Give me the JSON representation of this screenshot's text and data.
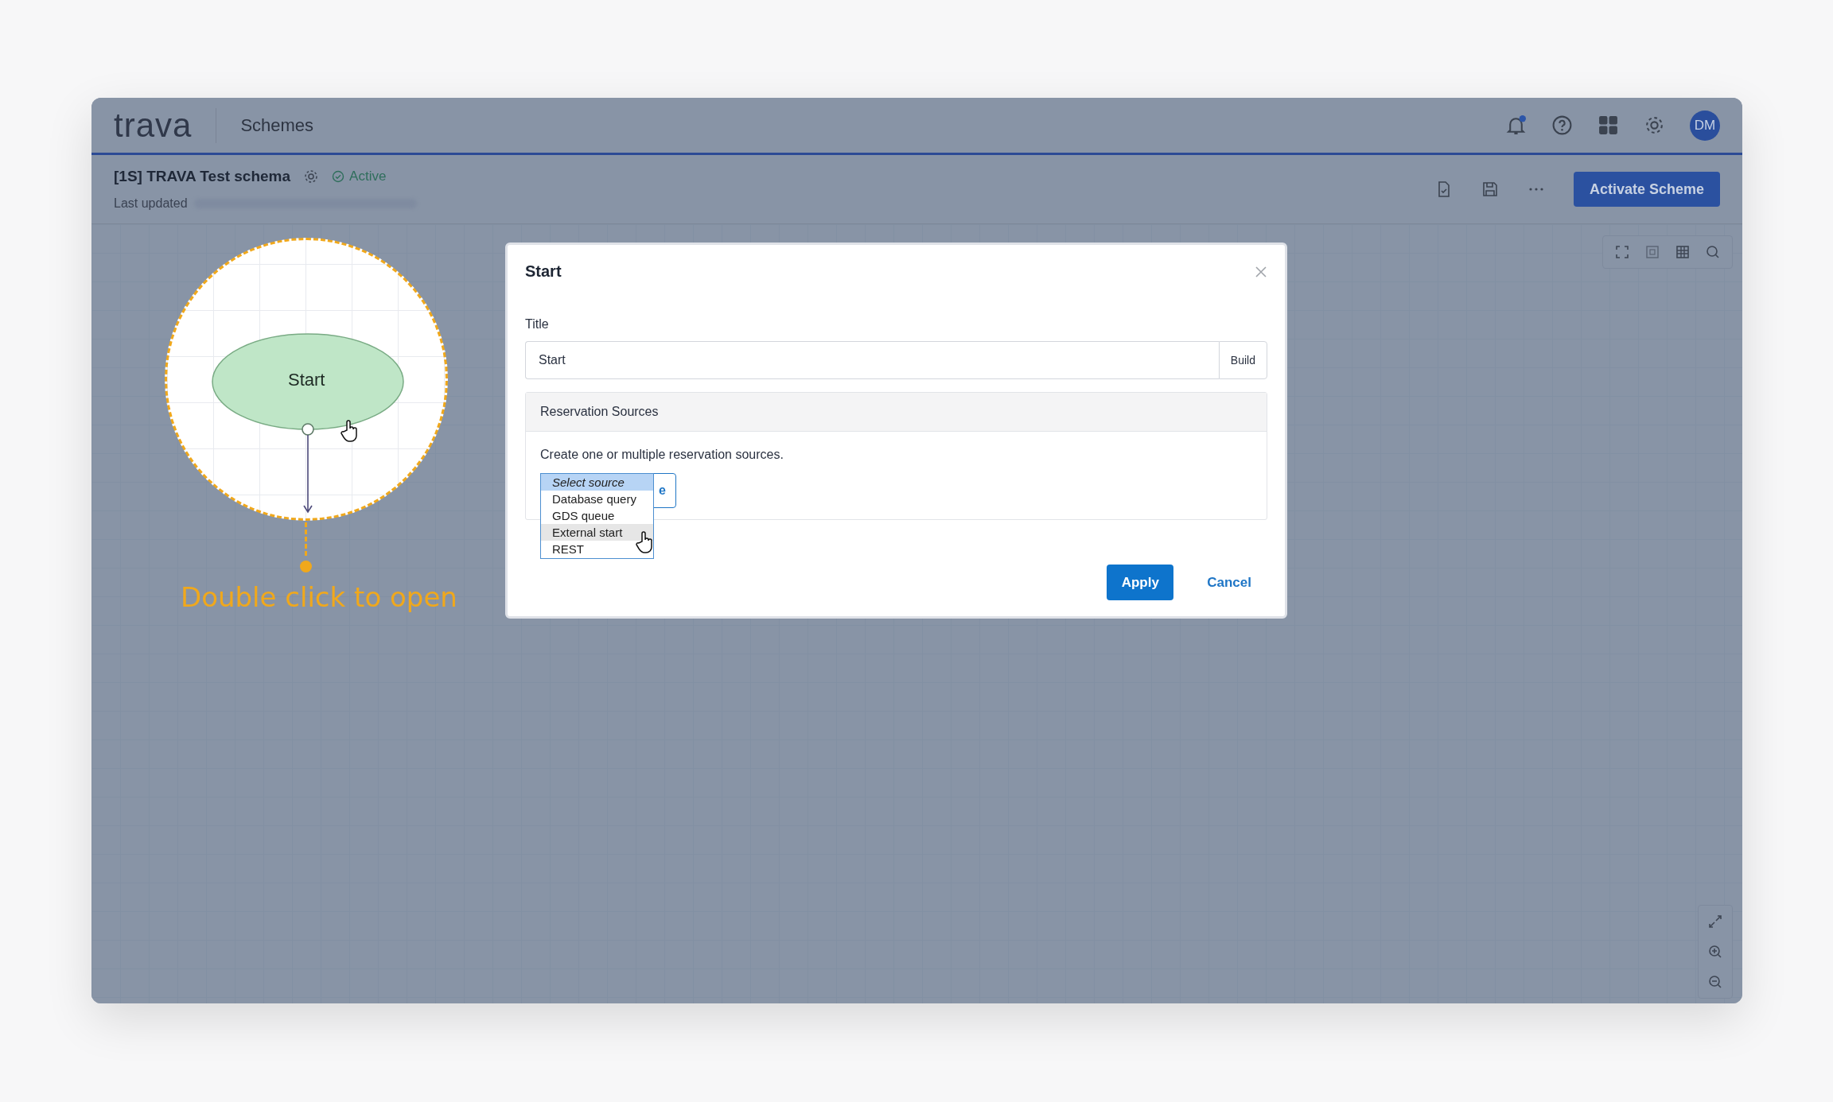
{
  "header": {
    "logo": "trava",
    "section": "Schemes",
    "notification_badge": true
  },
  "user": {
    "initials": "DM"
  },
  "schema": {
    "title": "[1S] TRAVA Test schema",
    "status": "Active",
    "last_updated_label": "Last updated"
  },
  "actions": {
    "primary": "Activate Scheme"
  },
  "canvas": {
    "node_label": "Start",
    "hint": "Double click to open"
  },
  "dialog": {
    "title": "Start",
    "field_label": "Title",
    "field_value": "Start",
    "build_button": "Build",
    "section_title": "Reservation Sources",
    "description": "Create one or multiple reservation sources.",
    "covered_button_text": "e",
    "options": [
      {
        "label": "Select source",
        "selected": true,
        "hovered": false
      },
      {
        "label": "Database query",
        "selected": false,
        "hovered": false
      },
      {
        "label": "GDS queue",
        "selected": false,
        "hovered": false
      },
      {
        "label": "External start",
        "selected": false,
        "hovered": true
      },
      {
        "label": "REST",
        "selected": false,
        "hovered": false
      }
    ],
    "apply": "Apply",
    "cancel": "Cancel"
  }
}
